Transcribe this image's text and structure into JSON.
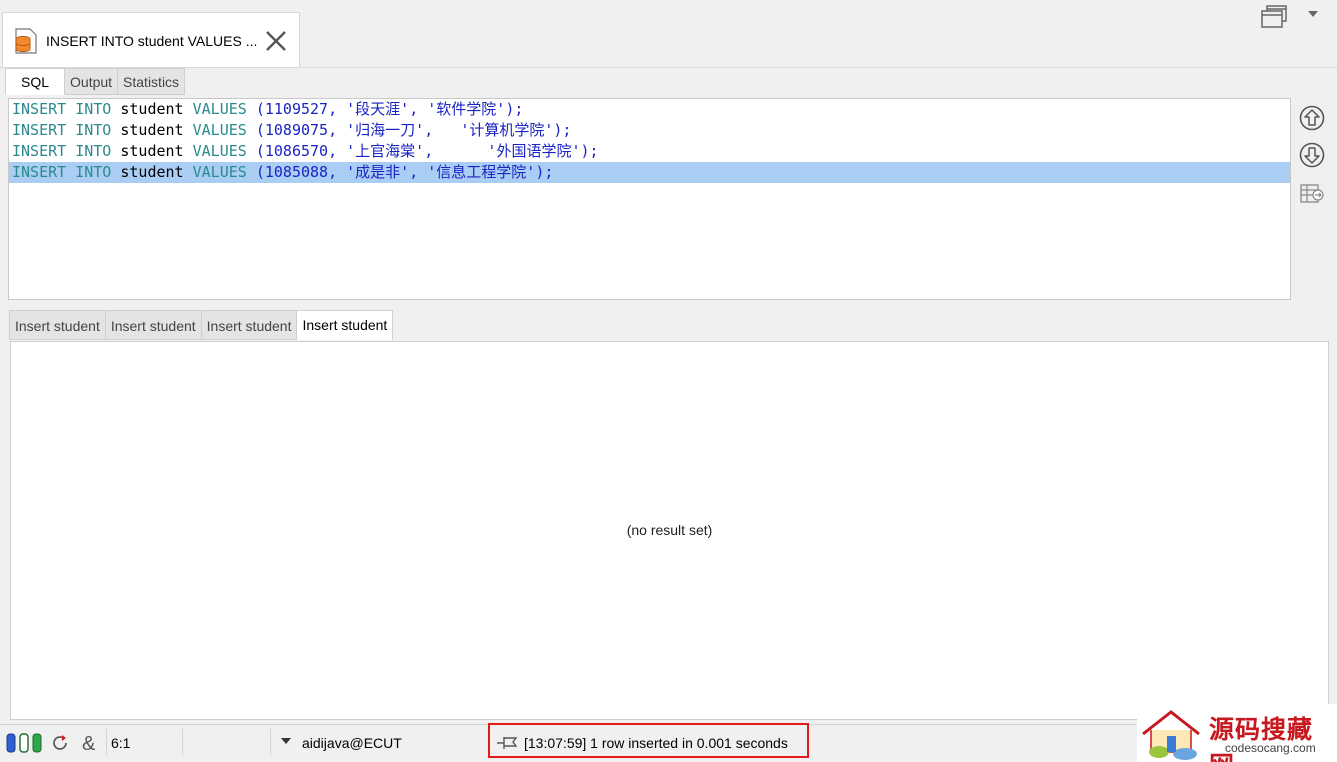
{
  "document_tab": {
    "title": "INSERT INTO student VALUES ...",
    "icon": "database-file-icon"
  },
  "sub_tabs": [
    {
      "label": "SQL",
      "active": true
    },
    {
      "label": "Output",
      "active": false
    },
    {
      "label": "Statistics",
      "active": false
    }
  ],
  "editor": {
    "lines": [
      {
        "kw1": "INSERT",
        "kw2": "INTO",
        "table": "student",
        "kw3": "VALUES",
        "rest": "(1109527, '段天涯', '软件学院');",
        "selected": false
      },
      {
        "kw1": "INSERT",
        "kw2": "INTO",
        "table": "student",
        "kw3": "VALUES",
        "rest": "(1089075, '归海一刀',   '计算机学院');",
        "selected": false
      },
      {
        "kw1": "INSERT",
        "kw2": "INTO",
        "table": "student",
        "kw3": "VALUES",
        "rest": "(1086570, '上官海棠',      '外国语学院');",
        "selected": false
      },
      {
        "kw1": "INSERT",
        "kw2": "INTO",
        "table": "student",
        "kw3": "VALUES",
        "rest": "(1085088, '成是非', '信息工程学院');",
        "selected": true
      }
    ]
  },
  "side_buttons": [
    "up-arrow-circle-icon",
    "down-arrow-circle-icon",
    "table-export-icon"
  ],
  "result_tabs": [
    {
      "label": "Insert student",
      "active": false
    },
    {
      "label": "Insert student",
      "active": false
    },
    {
      "label": "Insert student",
      "active": false
    },
    {
      "label": "Insert student",
      "active": true
    }
  ],
  "result": {
    "empty_text": "(no result set)"
  },
  "status_bar": {
    "cursor_pos": "6:1",
    "connection": "aidijava@ECUT",
    "message": "[13:07:59]  1 row inserted in 0.001 seconds"
  },
  "watermark": {
    "cn": "源码搜藏网",
    "en": "codesocang.com"
  },
  "colors": {
    "keyword": "#2b8a8f",
    "literal": "#1a24c4",
    "selection": "#a9cdf3",
    "highlight_box": "#e0191b"
  }
}
